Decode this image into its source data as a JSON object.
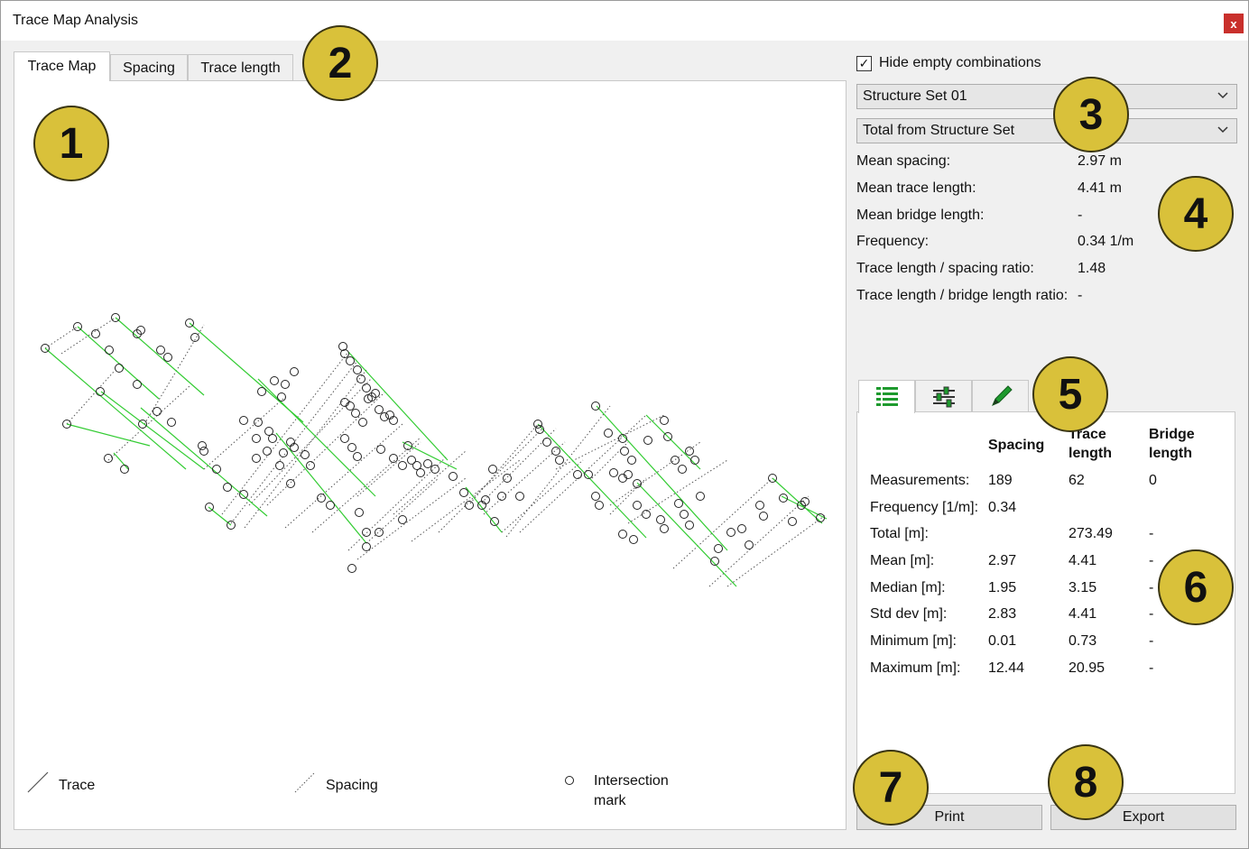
{
  "window": {
    "title": "Trace Map Analysis",
    "close_label": "x"
  },
  "tabs": [
    "Trace Map",
    "Spacing",
    "Trace length"
  ],
  "legend": {
    "trace": "Trace",
    "spacing": "Spacing",
    "intersection": "Intersection mark"
  },
  "hide_empty": {
    "label": "Hide empty combinations",
    "checked": true
  },
  "dropdowns": {
    "structure_set": "Structure Set 01",
    "subset": "Total from Structure Set"
  },
  "summary": [
    {
      "label": "Mean spacing:",
      "value": "2.97 m"
    },
    {
      "label": "Mean trace length:",
      "value": "4.41 m"
    },
    {
      "label": "Mean bridge length:",
      "value": "-"
    },
    {
      "label": "Frequency:",
      "value": "0.34 1/m"
    },
    {
      "label": "Trace length / spacing ratio:",
      "value": "1.48"
    },
    {
      "label": "Trace length / bridge length ratio:",
      "value": "-"
    }
  ],
  "sub_tabs": [
    "table-icon",
    "sliders-icon",
    "pencil-icon"
  ],
  "stats_table": {
    "headers": [
      "Spacing",
      "Trace length",
      "Bridge length"
    ],
    "rows": [
      {
        "label": "Measurements:",
        "spacing": "189",
        "trace": "62",
        "bridge": "0"
      },
      {
        "label": "Frequency [1/m]:",
        "spacing": "0.34",
        "trace": "",
        "bridge": ""
      },
      {
        "label": "Total [m]:",
        "spacing": "",
        "trace": "273.49",
        "bridge": "-"
      },
      {
        "label": "Mean [m]:",
        "spacing": "2.97",
        "trace": "4.41",
        "bridge": "-"
      },
      {
        "label": "Median [m]:",
        "spacing": "1.95",
        "trace": "3.15",
        "bridge": "-"
      },
      {
        "label": "Std dev [m]:",
        "spacing": "2.83",
        "trace": "4.41",
        "bridge": "-"
      },
      {
        "label": "Minimum [m]:",
        "spacing": "0.01",
        "trace": "0.73",
        "bridge": "-"
      },
      {
        "label": "Maximum [m]:",
        "spacing": "12.44",
        "trace": "20.95",
        "bridge": "-"
      }
    ]
  },
  "buttons": {
    "print": "Print",
    "export": "Export"
  },
  "callouts": [
    "1",
    "2",
    "3",
    "4",
    "5",
    "6",
    "7",
    "8"
  ],
  "colors": {
    "trace": "#33cc33",
    "spacing": "#555555",
    "badge": "#d9c13a",
    "close": "#c9302c",
    "icon_green": "#1e9a2e"
  }
}
